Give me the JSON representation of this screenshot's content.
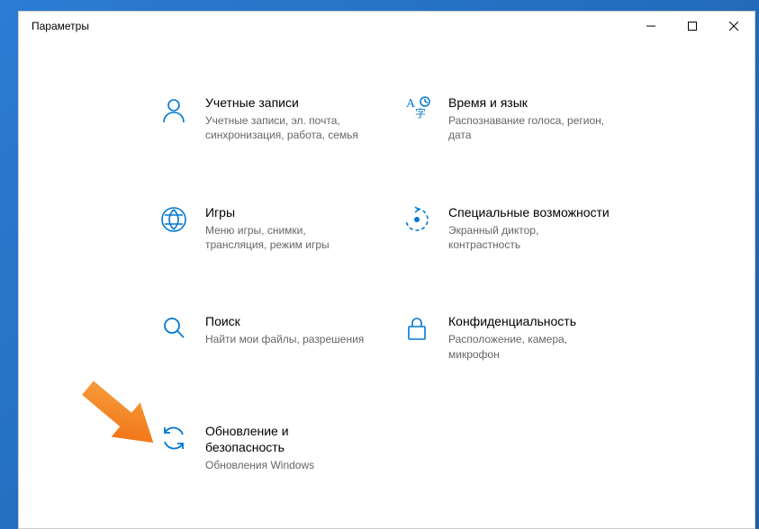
{
  "window": {
    "title": "Параметры"
  },
  "settings": {
    "accounts": {
      "title": "Учетные записи",
      "desc": "Учетные записи, эл. почта, синхронизация, работа, семья"
    },
    "time_language": {
      "title": "Время и язык",
      "desc": "Распознавание голоса, регион, дата"
    },
    "gaming": {
      "title": "Игры",
      "desc": "Меню игры, снимки, трансляция, режим игры"
    },
    "ease_of_access": {
      "title": "Специальные возможности",
      "desc": "Экранный диктор, контрастность"
    },
    "search": {
      "title": "Поиск",
      "desc": "Найти мои файлы, разрешения"
    },
    "privacy": {
      "title": "Конфиденциальность",
      "desc": "Расположение, камера, микрофон"
    },
    "update_security": {
      "title": "Обновление и безопасность",
      "desc": "Обновления Windows"
    }
  },
  "colors": {
    "accent": "#0078d4",
    "arrow": "#f57c1f"
  }
}
